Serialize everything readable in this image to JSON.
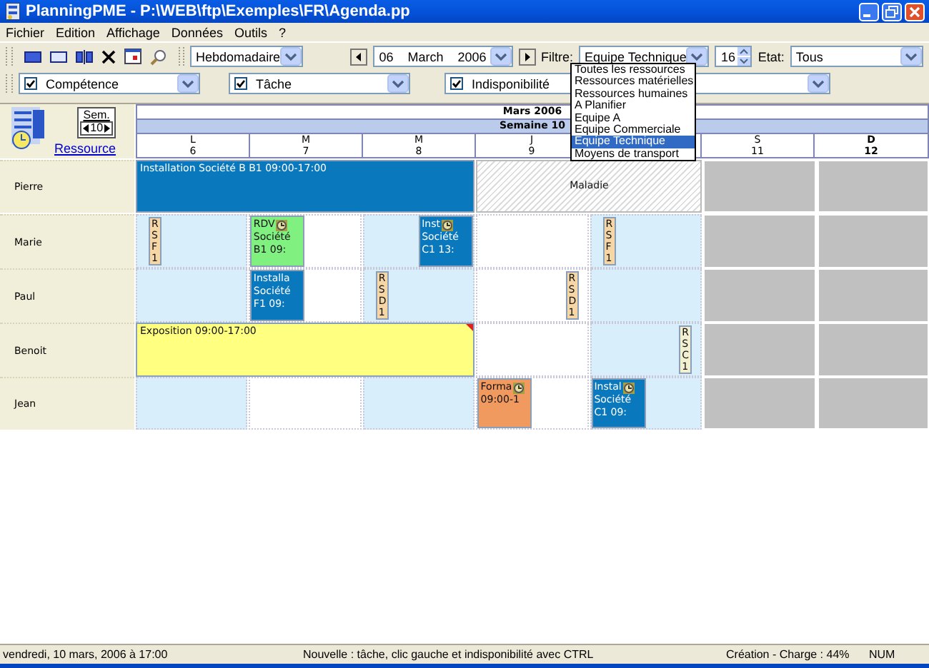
{
  "window": {
    "title": "PlanningPME - P:\\WEB\\ftp\\Exemples\\FR\\Agenda.pp"
  },
  "menu": [
    "Fichier",
    "Edition",
    "Affichage",
    "Données",
    "Outils",
    "?"
  ],
  "toolbar": {
    "view": "Hebdomadaire",
    "date": {
      "day": "06",
      "month": "March",
      "year": "2006"
    },
    "filter_label": "Filtre:",
    "filter": "Equipe Technique",
    "count": "16",
    "state_label": "Etat:",
    "state": "Tous"
  },
  "filters": [
    {
      "label": "Compétence",
      "checked": true
    },
    {
      "label": "Tâche",
      "checked": true
    },
    {
      "label": "Indisponibilité",
      "checked": true
    }
  ],
  "filter_dropdown": [
    {
      "label": "Toutes les ressources",
      "selected": false
    },
    {
      "label": "Ressources matérielles",
      "selected": false
    },
    {
      "label": "Ressources humaines",
      "selected": false
    },
    {
      "label": "A Planifier",
      "selected": false
    },
    {
      "label": "Equipe A",
      "selected": false
    },
    {
      "label": "Equipe Commerciale",
      "selected": false
    },
    {
      "label": "Equipe Technique",
      "selected": true
    },
    {
      "label": "Moyens de transport",
      "selected": false
    }
  ],
  "planning": {
    "week_button": "Sem.",
    "week_number": "10",
    "resource_link": "Ressource",
    "month": "Mars 2006",
    "week": "Semaine 10",
    "days": [
      {
        "letter": "L",
        "number": "6",
        "weekend": false,
        "emphasized": false
      },
      {
        "letter": "M",
        "number": "7",
        "weekend": false,
        "emphasized": false
      },
      {
        "letter": "M",
        "number": "8",
        "weekend": false,
        "emphasized": false
      },
      {
        "letter": "J",
        "number": "9",
        "weekend": false,
        "emphasized": false
      },
      {
        "weekend": false
      },
      {
        "letter": "S",
        "number": "11",
        "weekend": true,
        "emphasized": false
      },
      {
        "letter": "D",
        "number": "12",
        "weekend": true,
        "emphasized": true
      }
    ],
    "resources": [
      {
        "name": "Pierre",
        "cells": [
          {
            "events": [
              {
                "kind": "three-day-bar",
                "lines": [
                  "Installation Société B  B1 09:00-17:00"
                ],
                "color": "#0a78bc",
                "flag": false,
                "reminder": false,
                "afternoon": false
              }
            ]
          },
          {},
          {},
          {
            "events": [
              {
                "kind": "two-day-absence",
                "lines": [
                  "Maladie"
                ],
                "afternoon": false,
                "flag": false,
                "reminder": false
              }
            ]
          },
          {},
          {},
          {}
        ]
      },
      {
        "name": "Marie",
        "cells": [
          {
            "events": [
              {
                "kind": "tag",
                "lines": [
                  "RSF1"
                ],
                "color": "#f5d6a4",
                "afternoon": false,
                "flag": false,
                "reminder": false
              }
            ]
          },
          {
            "events": [
              {
                "kind": "block",
                "lines": [
                  "RDV",
                  "Société",
                  "B1 09:"
                ],
                "color": "#80f080",
                "afternoon": false,
                "flag": false,
                "reminder": true
              }
            ]
          },
          {
            "events": [
              {
                "kind": "block",
                "lines": [
                  "Inst",
                  "Société",
                  "C1 13:"
                ],
                "color": "#0a78bc",
                "afternoon": true,
                "flag": false,
                "reminder": true
              }
            ]
          },
          {},
          {
            "events": [
              {
                "kind": "tag",
                "lines": [
                  "RSF1"
                ],
                "color": "#f5d6a4",
                "afternoon": false,
                "flag": false,
                "reminder": false
              }
            ]
          },
          {},
          {}
        ]
      },
      {
        "name": "Paul",
        "cells": [
          {},
          {
            "events": [
              {
                "kind": "block",
                "lines": [
                  "Installa",
                  "Société",
                  "F1 09:"
                ],
                "color": "#0a78bc",
                "afternoon": false,
                "flag": false,
                "reminder": false
              }
            ]
          },
          {
            "events": [
              {
                "kind": "tag",
                "lines": [
                  "RSD1"
                ],
                "color": "#f5d6a4",
                "afternoon": false,
                "flag": false,
                "reminder": false
              }
            ]
          },
          {
            "events": [
              {
                "kind": "tag",
                "lines": [
                  "RSD1"
                ],
                "color": "#f5d6a4",
                "afternoon": true,
                "flag": false,
                "reminder": false
              }
            ]
          },
          {},
          {},
          {}
        ]
      },
      {
        "name": "Benoit",
        "cells": [
          {
            "events": [
              {
                "kind": "three-day-bar",
                "lines": [
                  "Exposition 09:00-17:00"
                ],
                "color": "#ffff80",
                "afternoon": false,
                "flag": true,
                "reminder": false
              }
            ]
          },
          {},
          {},
          {},
          {
            "events": [
              {
                "kind": "tag",
                "lines": [
                  "RSC1"
                ],
                "color": "#f2f0d0",
                "afternoon": true,
                "flag": false,
                "reminder": false
              }
            ]
          },
          {},
          {}
        ]
      },
      {
        "name": "Jean",
        "cells": [
          {},
          {},
          {},
          {
            "events": [
              {
                "kind": "block",
                "lines": [
                  "Forma",
                  "09:00-1"
                ],
                "color": "#f09a60",
                "afternoon": false,
                "flag": false,
                "reminder": true
              }
            ]
          },
          {
            "events": [
              {
                "kind": "block",
                "lines": [
                  "Instal",
                  "Société",
                  "C1 09:"
                ],
                "color": "#0a78bc",
                "afternoon": false,
                "flag": false,
                "reminder": true
              }
            ]
          },
          {},
          {}
        ]
      }
    ]
  },
  "status_bar": {
    "date": "vendredi, 10 mars, 2006 à 17:00",
    "hint": "Nouvelle : tâche, clic gauche et indisponibilité avec CTRL",
    "info": "Création - Charge : 44%",
    "mode": "NUM"
  }
}
